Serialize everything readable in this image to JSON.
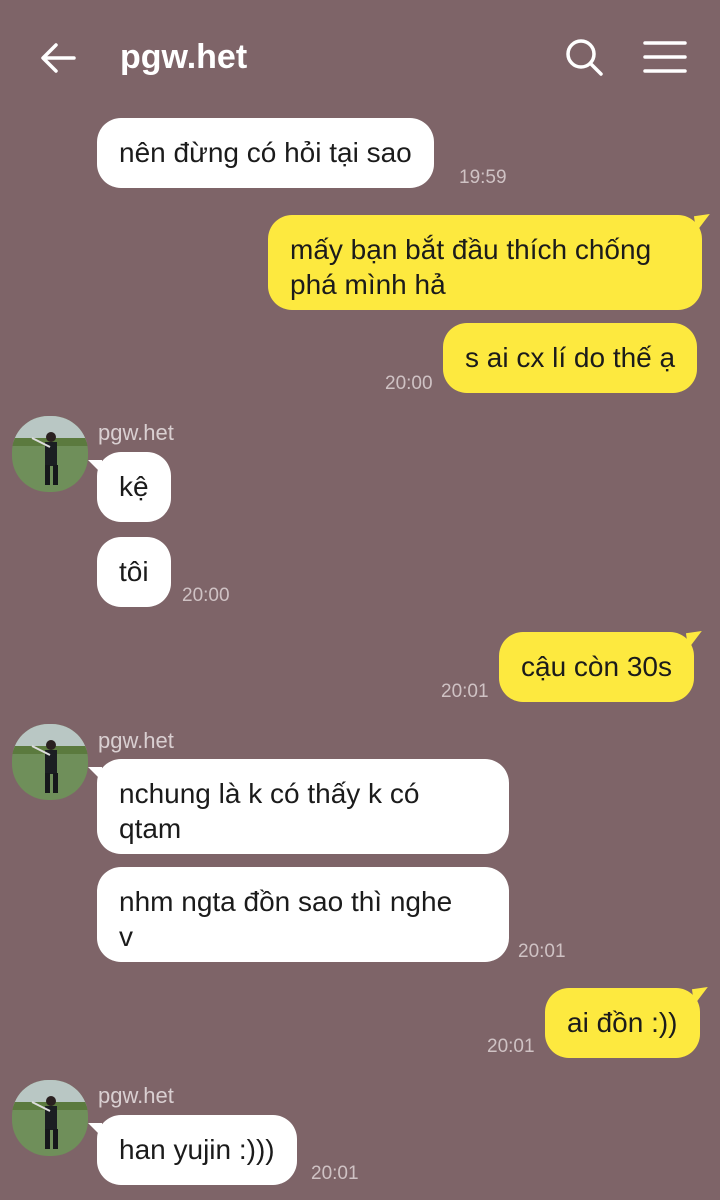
{
  "header": {
    "title": "pgw.het",
    "back_icon": "back-arrow-icon",
    "search_icon": "search-icon",
    "menu_icon": "hamburger-menu-icon"
  },
  "colors": {
    "background": "#7e6468",
    "incoming_bubble": "#ffffff",
    "outgoing_bubble": "#fde93f"
  },
  "messages": [
    {
      "dir": "in",
      "text": "nên đừng có hỏi tại sao",
      "time": "19:59"
    },
    {
      "dir": "out",
      "text": "mấy bạn bắt đầu thích chống\nphá mình hả"
    },
    {
      "dir": "out",
      "text": "s ai cx lí do thế ạ",
      "time": "20:00"
    },
    {
      "dir": "in",
      "sender": "pgw.het",
      "text": "kệ"
    },
    {
      "dir": "in",
      "text": "tôi",
      "time": "20:00"
    },
    {
      "dir": "out",
      "text": "cậu còn 30s",
      "time": "20:01"
    },
    {
      "dir": "in",
      "sender": "pgw.het",
      "text": "nchung là k có thấy k có\nqtam"
    },
    {
      "dir": "in",
      "text": "nhm ngta đồn sao thì nghe\nv",
      "time": "20:01"
    },
    {
      "dir": "out",
      "text": "ai đồn :))",
      "time": "20:01"
    },
    {
      "dir": "in",
      "sender": "pgw.het",
      "text": "han yujin :)))",
      "time": "20:01"
    }
  ]
}
